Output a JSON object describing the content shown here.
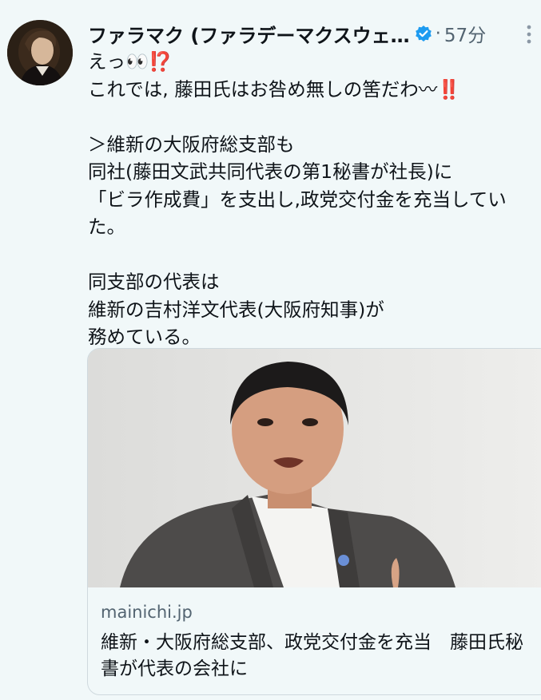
{
  "author": {
    "display_name": "ファラマク (ファラデーマクスウェ…",
    "verified_icon": "verified-badge-icon",
    "separator": "·",
    "time": "57分"
  },
  "tweet": {
    "line1_text": "えっ",
    "line1_emoji1": "👀",
    "line1_emoji2": "⁉️",
    "line2_text": "これでは, 藤田氏はお咎め無しの筈だわ",
    "line2_emoji1": "〰",
    "line2_emoji2": "‼️",
    "line4": "＞維新の大阪府総支部も",
    "line5": "同社(藤田文武共同代表の第1秘書が社長)に",
    "line6": "「ビラ作成費」を支出し,政党交付金を充当してい",
    "line7": "た。",
    "line9": "同支部の代表は",
    "line10": "維新の吉村洋文代表(大阪府知事)が",
    "line11": "務めている。"
  },
  "card": {
    "domain": "mainichi.jp",
    "title": "維新・大阪府総支部、政党交付金を充当　藤田氏秘書が代表の会社に"
  },
  "colors": {
    "background": "#f1f8f9",
    "text": "#0f1419",
    "secondary": "#536471",
    "verified": "#1d9bf0",
    "emoji_red": "#e0245e"
  }
}
